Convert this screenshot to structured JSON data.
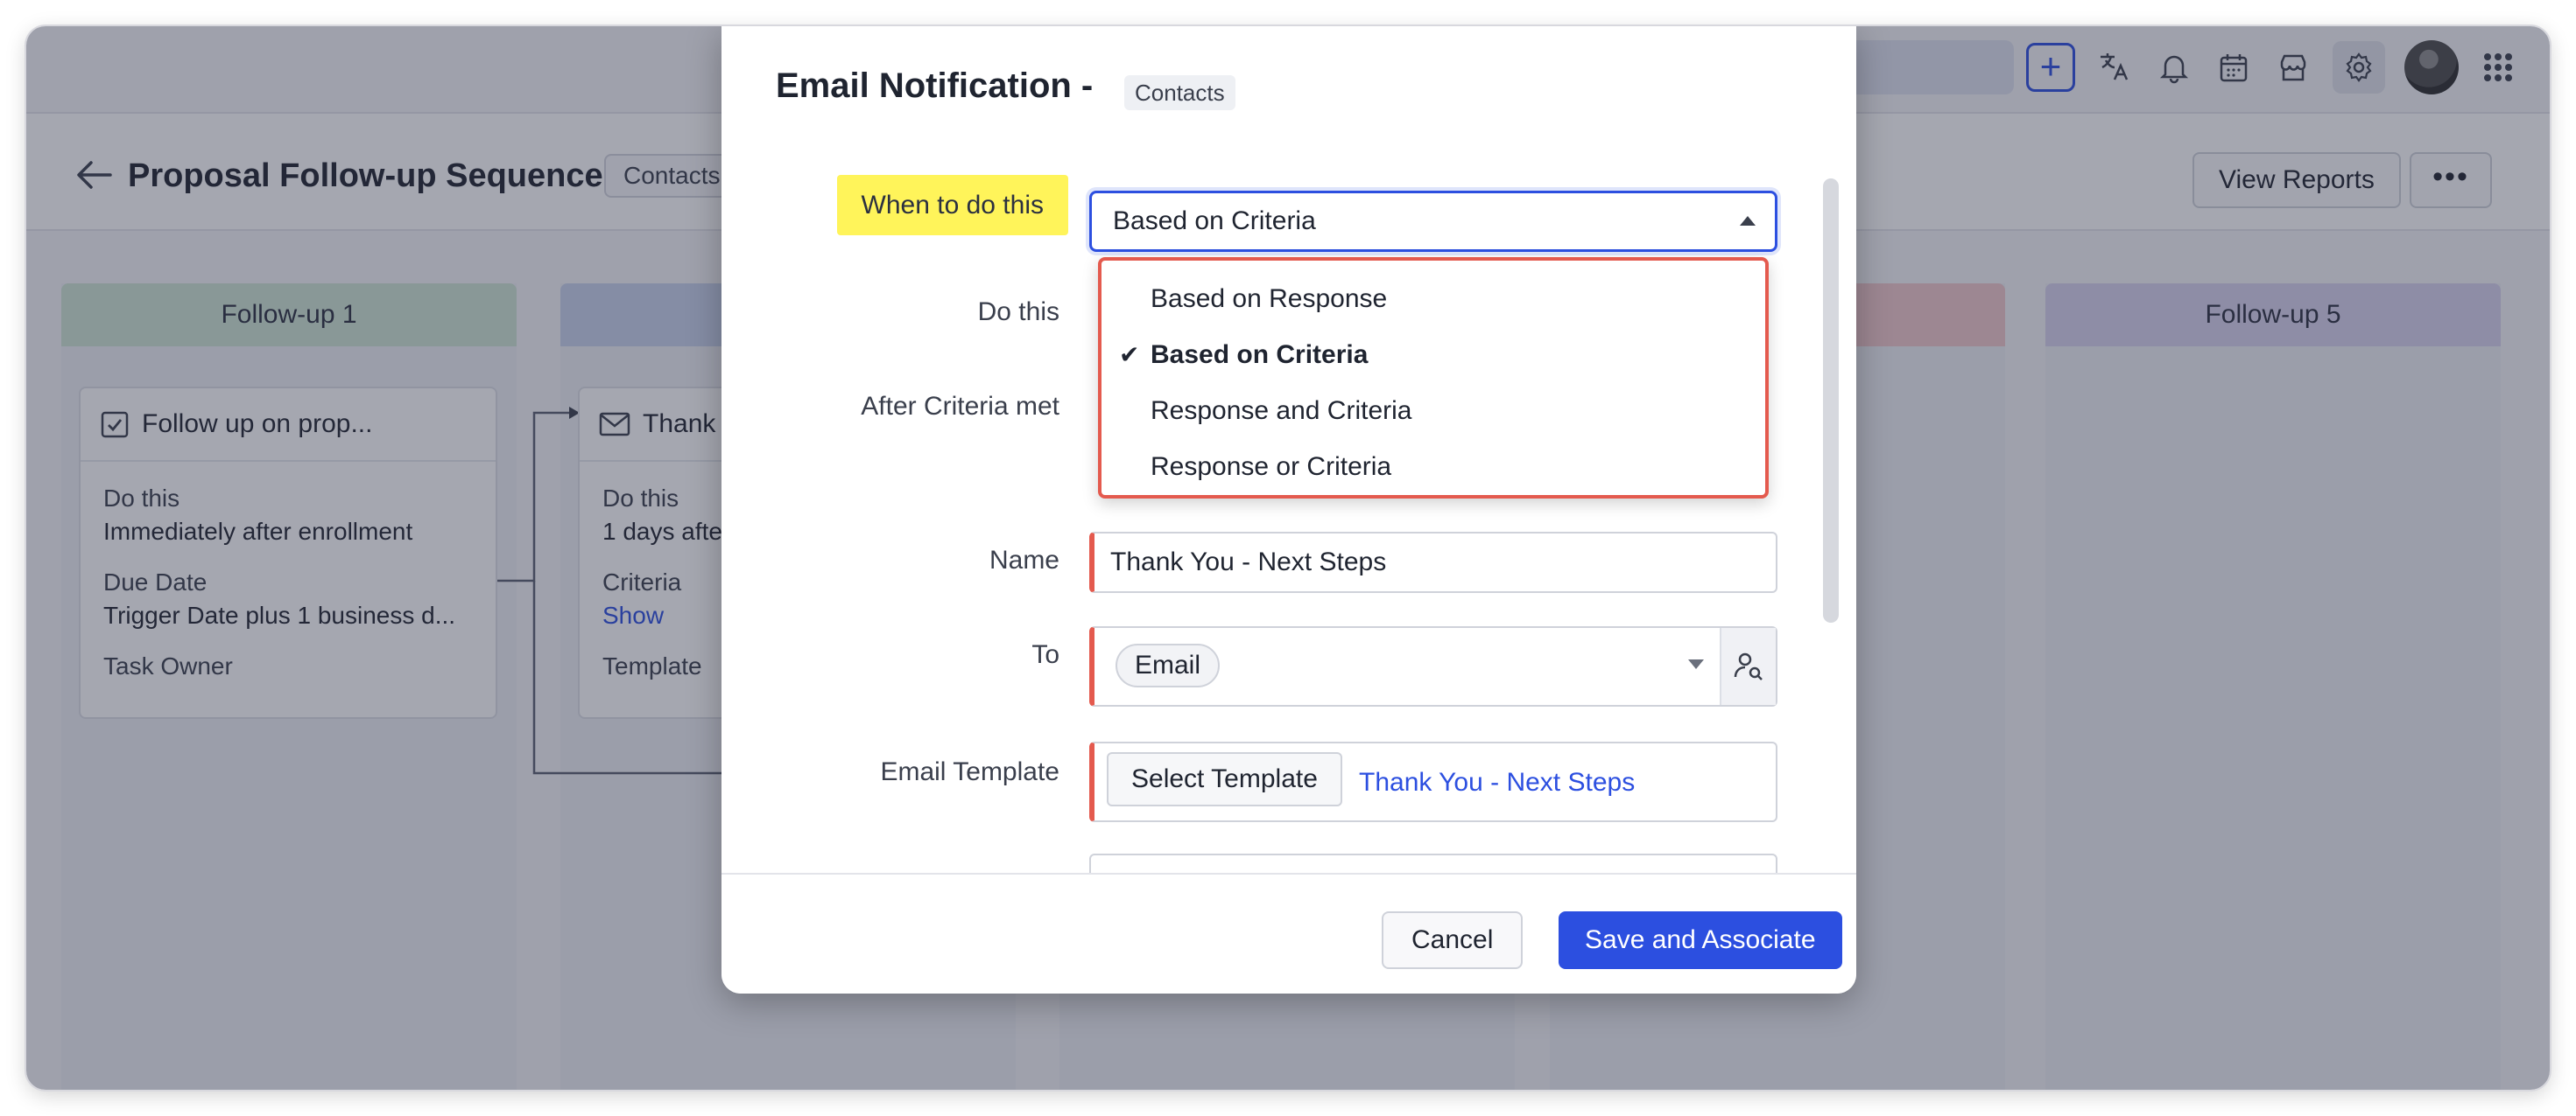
{
  "topbar": {
    "icons": [
      "add-icon",
      "translate-icon",
      "bell-icon",
      "calendar-icon",
      "marketplace-icon",
      "gear-icon",
      "avatar",
      "apps-grid-icon"
    ],
    "plus_label": "+"
  },
  "header": {
    "title": "Proposal Follow-up Sequence",
    "module": "Contacts",
    "view_reports": "View Reports",
    "more": "•••"
  },
  "board": {
    "columns": [
      {
        "label": "Follow-up 1",
        "color": "#cfe6d4"
      },
      {
        "label": "",
        "color": "#c9d3ec"
      },
      {
        "label": "",
        "color": "#e8eaf0"
      },
      {
        "label": "",
        "color": "#f2c9cc"
      },
      {
        "label": "Follow-up 5",
        "color": "#d8d2ee"
      }
    ],
    "card1": {
      "title": "Follow up on prop...",
      "do_this_label": "Do this",
      "do_this_value": "Immediately after enrollment",
      "due_label": "Due Date",
      "due_value": "Trigger Date plus 1 business d...",
      "owner_label": "Task Owner"
    },
    "card2": {
      "title": "Thank Y",
      "do_this_label": "Do this",
      "do_this_value": "1 days afte",
      "criteria_label": "Criteria",
      "criteria_value": "Show",
      "template_label": "Template"
    }
  },
  "modal": {
    "title": "Email Notification -",
    "module": "Contacts",
    "labels": {
      "when": "When to do this",
      "do_this": "Do this",
      "after_criteria": "After Criteria met",
      "name": "Name",
      "to": "To",
      "email_template": "Email Template"
    },
    "when_select": {
      "value": "Based on Criteria",
      "options": [
        "Based on Response",
        "Based on Criteria",
        "Response and Criteria",
        "Response or Criteria"
      ],
      "selected_index": 1
    },
    "name_value": "Thank You - Next Steps",
    "to_chip": "Email",
    "template_button": "Select Template",
    "template_name": "Thank You - Next Steps",
    "cancel": "Cancel",
    "save": "Save and Associate"
  },
  "colors": {
    "accent": "#2c4fe0",
    "required": "#e45a4e",
    "highlight": "#fff45a",
    "dropdown_outline": "#e45a4e"
  }
}
